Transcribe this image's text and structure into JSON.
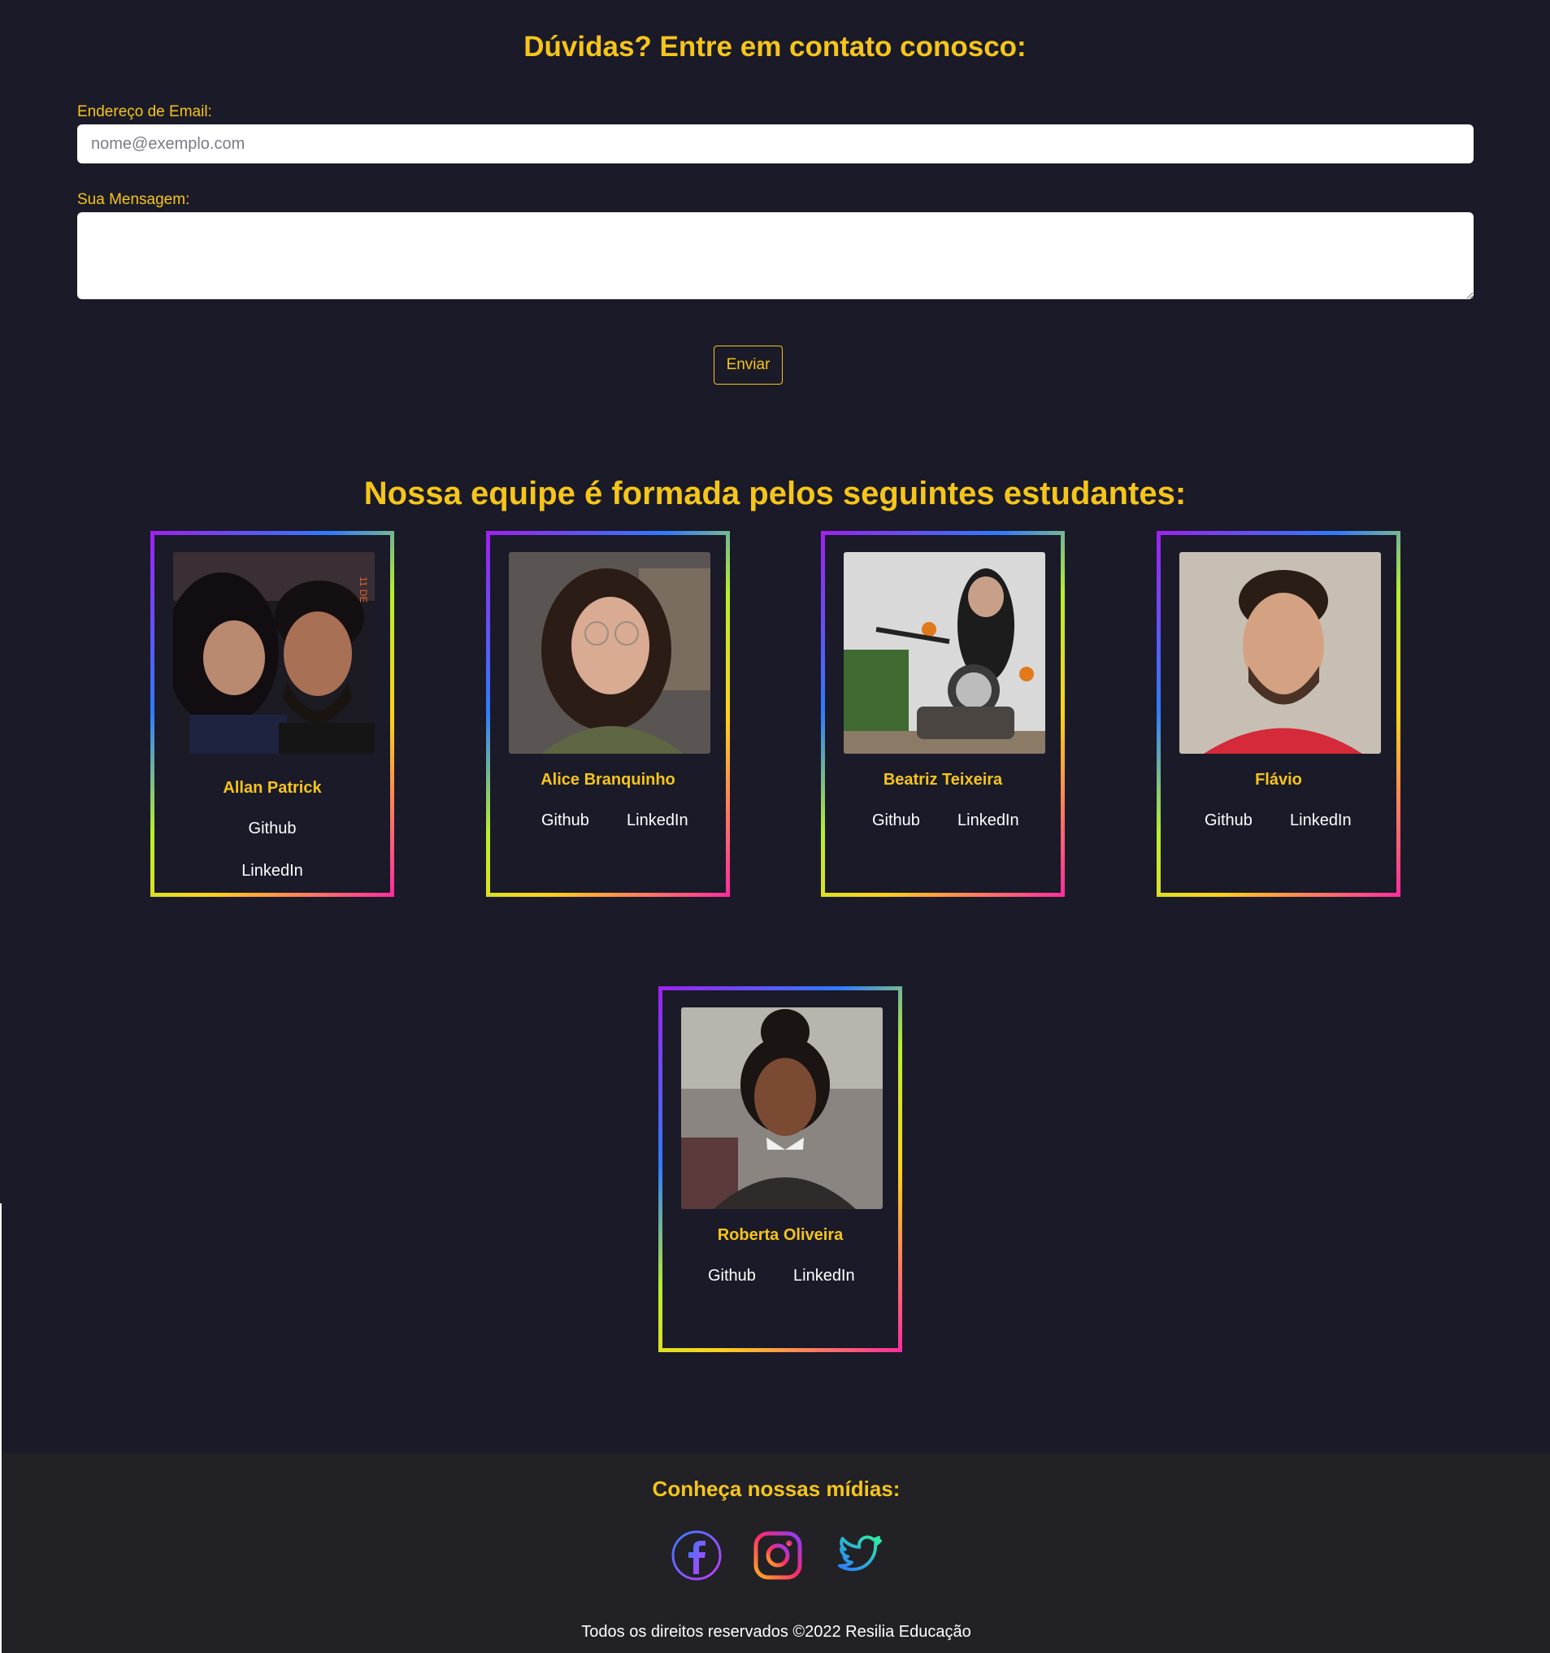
{
  "contact": {
    "title": "Dúvidas? Entre em contato conosco:",
    "email_label": "Endereço de Email:",
    "email_placeholder": "nome@exemplo.com",
    "message_label": "Sua Mensagem:",
    "message_value": "",
    "send_label": "Enviar"
  },
  "team": {
    "title": "Nossa equipe é formada pelos seguintes estudantes:",
    "members": [
      {
        "name": "Allan Patrick",
        "github": "Github",
        "linkedin": "LinkedIn"
      },
      {
        "name": "Alice Branquinho",
        "github": "Github",
        "linkedin": "LinkedIn"
      },
      {
        "name": "Beatriz Teixeira",
        "github": "Github",
        "linkedin": "LinkedIn"
      },
      {
        "name": "Flávio",
        "github": "Github",
        "linkedin": "LinkedIn"
      },
      {
        "name": "Roberta Oliveira",
        "github": "Github",
        "linkedin": "LinkedIn"
      }
    ]
  },
  "footer": {
    "title": "Conheça nossas mídias:",
    "social": [
      "facebook-icon",
      "instagram-icon",
      "twitter-icon"
    ],
    "copyright": "Todos os direitos reservados ©2022 Resilia Educação"
  },
  "colors": {
    "background": "#1b1a28",
    "accent": "#f5c51a",
    "footer_background": "#212126"
  }
}
